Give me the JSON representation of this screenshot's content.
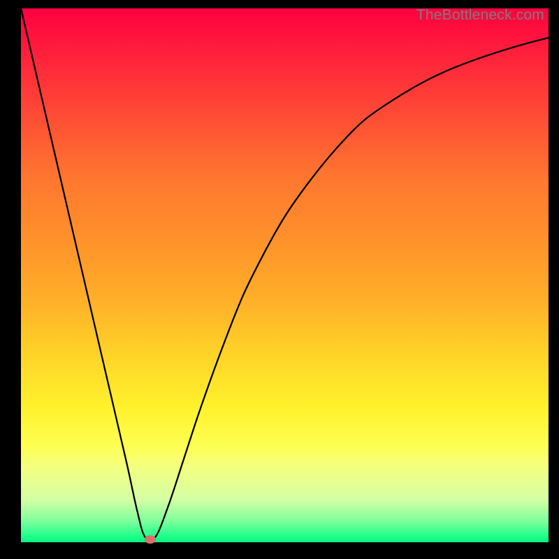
{
  "attribution": "TheBottleneck.com",
  "chart_data": {
    "type": "line",
    "title": "",
    "xlabel": "",
    "ylabel": "",
    "xlim": [
      0,
      100
    ],
    "ylim": [
      0,
      100
    ],
    "grid": false,
    "legend": false,
    "axes_visible": false,
    "background_gradient": {
      "top": "#ff0040",
      "bottom": "#08f57d",
      "direction": "vertical"
    },
    "series": [
      {
        "name": "bottleneck-curve",
        "color": "#000000",
        "x": [
          0,
          4,
          8,
          12,
          16,
          20,
          22,
          23.5,
          25.5,
          28,
          31,
          34,
          38,
          42,
          46,
          50,
          55,
          60,
          65,
          70,
          75,
          80,
          85,
          90,
          95,
          100
        ],
        "values": [
          100,
          83,
          66,
          49,
          32,
          15,
          6,
          1,
          1,
          7,
          16,
          25,
          36,
          46,
          54,
          61,
          68,
          74,
          79,
          82.5,
          85.5,
          88,
          90,
          91.7,
          93.2,
          94.5
        ]
      }
    ],
    "markers": [
      {
        "name": "minimum-marker",
        "x": 24.5,
        "y": 0.5,
        "color": "#dd6f6f"
      }
    ]
  }
}
